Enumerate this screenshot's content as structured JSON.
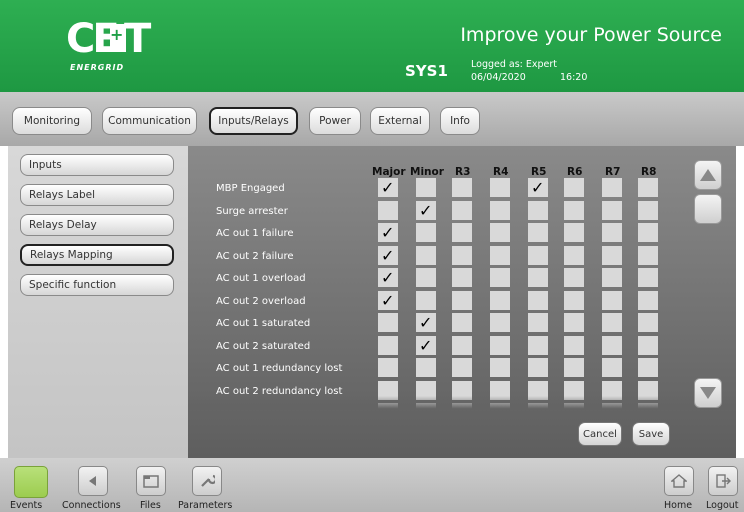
{
  "header": {
    "logo_text": "CE+T",
    "logo_sub": "ENERGRID",
    "tagline": "Improve your Power Source",
    "system": "SYS1",
    "logged_as": "Logged as: Expert",
    "date": "06/04/2020",
    "time": "16:20",
    "brand_color": "#1fa047"
  },
  "tabs": [
    {
      "label": "Monitoring"
    },
    {
      "label": "Communication"
    },
    {
      "label": "Inputs/Relays",
      "active": true
    },
    {
      "label": "Power"
    },
    {
      "label": "External"
    },
    {
      "label": "Info"
    }
  ],
  "sidebar": {
    "items": [
      {
        "label": "Inputs"
      },
      {
        "label": "Relays Label"
      },
      {
        "label": "Relays Delay"
      },
      {
        "label": "Relays Mapping",
        "active": true
      },
      {
        "label": "Specific function"
      }
    ]
  },
  "mapping": {
    "columns": [
      "Major",
      "Minor",
      "R3",
      "R4",
      "R5",
      "R6",
      "R7",
      "R8"
    ],
    "rows": [
      {
        "label": "MBP Engaged",
        "checked": [
          "Major",
          "R5"
        ]
      },
      {
        "label": "Surge arrester",
        "checked": [
          "Minor"
        ]
      },
      {
        "label": "AC out 1 failure",
        "checked": [
          "Major"
        ]
      },
      {
        "label": "AC out 2 failure",
        "checked": [
          "Major"
        ]
      },
      {
        "label": "AC out 1 overload",
        "checked": [
          "Major"
        ]
      },
      {
        "label": "AC out 2 overload",
        "checked": [
          "Major"
        ]
      },
      {
        "label": "AC out 1 saturated",
        "checked": [
          "Minor"
        ]
      },
      {
        "label": "AC out 2 saturated",
        "checked": [
          "Minor"
        ]
      },
      {
        "label": "AC out 1 redundancy lost",
        "checked": []
      },
      {
        "label": "AC out 2 redundancy lost",
        "checked": []
      }
    ],
    "cancel_label": "Cancel",
    "save_label": "Save"
  },
  "footer": {
    "items": [
      {
        "label": "Events",
        "icon": "events-icon"
      },
      {
        "label": "Connections",
        "icon": "connections-icon"
      },
      {
        "label": "Files",
        "icon": "files-icon"
      },
      {
        "label": "Parameters",
        "icon": "parameters-icon"
      },
      {
        "label": "Home",
        "icon": "home-icon"
      },
      {
        "label": "Logout",
        "icon": "logout-icon"
      }
    ]
  }
}
